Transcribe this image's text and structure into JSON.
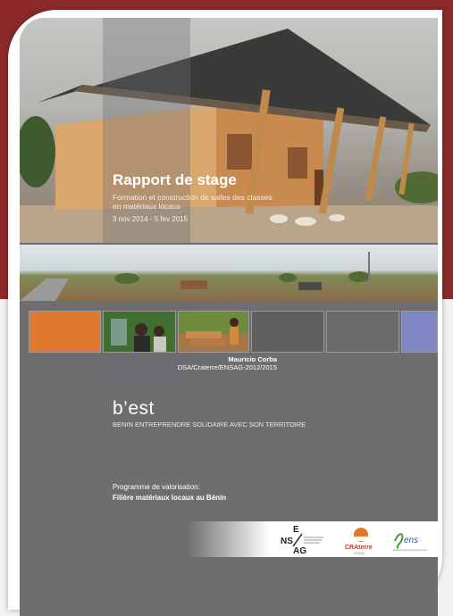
{
  "cover": {
    "title": "Rapport de stage",
    "subtitle": "Formation et construction de salles des classes en matériaux locaux",
    "dates": "3 nov 2014 - 5 fev 2015",
    "author_name": "Mauricio Corba",
    "author_affiliation": "DSA/Craterre/ENSAG-2012/2015",
    "brand_name": "b’est",
    "brand_tagline": "BENIN ENTREPRENDRE SOLIDAIRE AVEC SON TERRITOIRE",
    "program_label": "Programme de valorisation:",
    "program_name": "Filière matériaux locaux au Bénin"
  },
  "logos": {
    "ensag": {
      "top": "E",
      "middle": "NS",
      "bottom": "AG"
    },
    "craterre": {
      "label": "CRAterre",
      "sub": "ENSAG"
    },
    "sens": {
      "label": "ens",
      "sub": "Solidarités Entreprises Nord-Sud"
    }
  },
  "colors": {
    "background_maroon": "#8c2a2a",
    "page_grey": "#6e6e70",
    "tile_orange": "#e0782f",
    "tile_blue": "#8086c4",
    "tile_grey": "#5f5f61"
  },
  "icons": [
    "ensag-logo",
    "craterre-logo",
    "sens-logo"
  ]
}
